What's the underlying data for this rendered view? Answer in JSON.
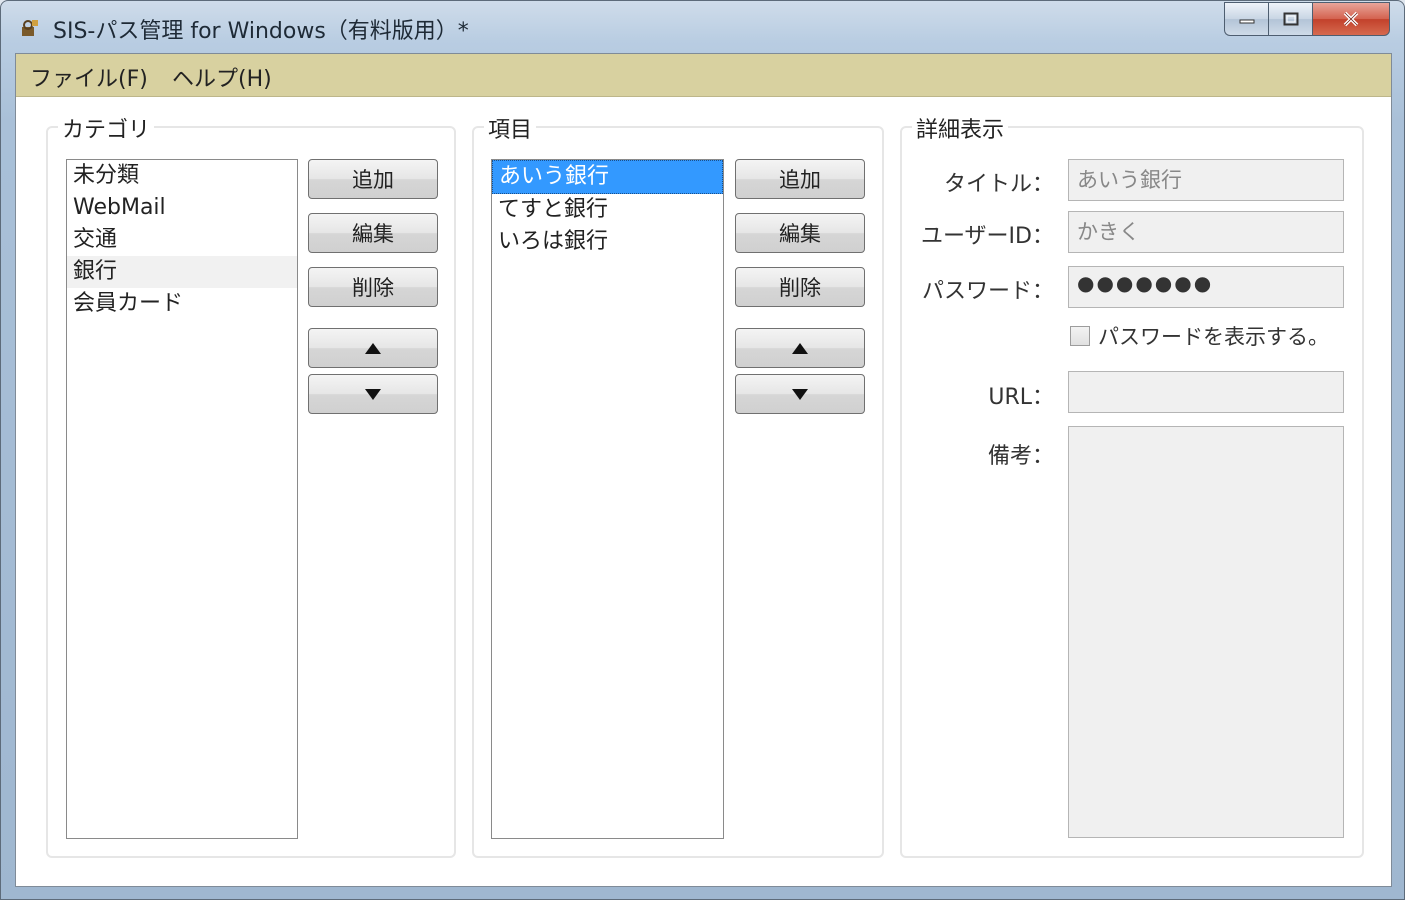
{
  "window": {
    "title": "SIS-パス管理 for Windows（有料版用）*"
  },
  "menu": {
    "file": "ファイル(F)",
    "help": "ヘルプ(H)"
  },
  "category": {
    "title": "カテゴリ",
    "items": [
      "未分類",
      "WebMail",
      "交通",
      "銀行",
      "会員カード"
    ],
    "hover_index": 3,
    "add_label": "追加",
    "edit_label": "編集",
    "delete_label": "削除"
  },
  "entries": {
    "title": "項目",
    "items": [
      "あいう銀行",
      "てすと銀行",
      "いろは銀行"
    ],
    "selected_index": 0,
    "add_label": "追加",
    "edit_label": "編集",
    "delete_label": "削除"
  },
  "details": {
    "title": "詳細表示",
    "title_label": "タイトル：",
    "title_value": "あいう銀行",
    "userid_label": "ユーザーID：",
    "userid_value": "かきく",
    "password_label": "パスワード：",
    "password_value": "●●●●●●●",
    "show_password_label": "パスワードを表示する。",
    "url_label": "URL：",
    "url_value": "",
    "notes_label": "備考：",
    "notes_value": ""
  },
  "colors": {
    "menubar": "#d8d1a0",
    "selection": "#3399ff",
    "close_button": "#c2412b"
  }
}
